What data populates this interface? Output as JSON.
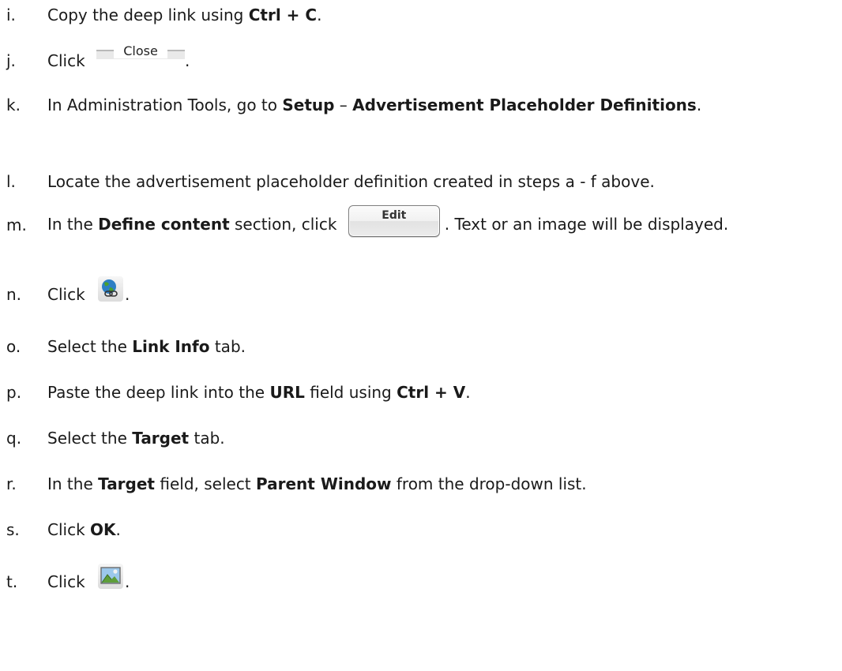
{
  "steps": [
    {
      "marker": "i.",
      "pre": "Copy the deep link using ",
      "bold": "Ctrl + C",
      "post": "."
    },
    {
      "marker": "j.",
      "pre": "Click ",
      "button_label": "Close",
      "post": "."
    },
    {
      "marker": "k.",
      "pre": "In Administration Tools, go to ",
      "bold1": "Setup",
      "mid": " – ",
      "bold2": "Advertisement Placeholder Definitions",
      "post": "."
    },
    {
      "marker": "l.",
      "text": "Locate the advertisement placeholder definition created in steps a - f above."
    },
    {
      "marker": "m.",
      "pre": "In the ",
      "bold": "Define content",
      "mid": " section, click ",
      "button_label": "Edit",
      "post": ". Text or an image will be displayed."
    },
    {
      "marker": "n.",
      "pre": "Click ",
      "icon": "link-globe-icon",
      "post": "."
    },
    {
      "marker": "o.",
      "pre": "Select the ",
      "bold": "Link Info",
      "post": " tab."
    },
    {
      "marker": "p.",
      "pre": "Paste the deep link into the ",
      "bold1": "URL",
      "mid": " field using ",
      "bold2": "Ctrl + V",
      "post": "."
    },
    {
      "marker": "q.",
      "pre": "Select the ",
      "bold": "Target",
      "post": " tab."
    },
    {
      "marker": "r.",
      "pre": "In the ",
      "bold1": "Target",
      "mid": " field, select ",
      "bold2": "Parent Window",
      "post": " from the drop-down list."
    },
    {
      "marker": "s.",
      "pre": "Click ",
      "bold": "OK",
      "post": "."
    },
    {
      "marker": "t.",
      "pre": "Click ",
      "icon": "insert-image-icon",
      "post": "."
    }
  ],
  "colors": {
    "text": "#1a1a1a",
    "background": "#ffffff",
    "globe_blue": "#2d7fc4",
    "globe_green": "#4aa02c",
    "image_sky": "#9cc8ec",
    "image_hill": "#5e9e3a"
  }
}
